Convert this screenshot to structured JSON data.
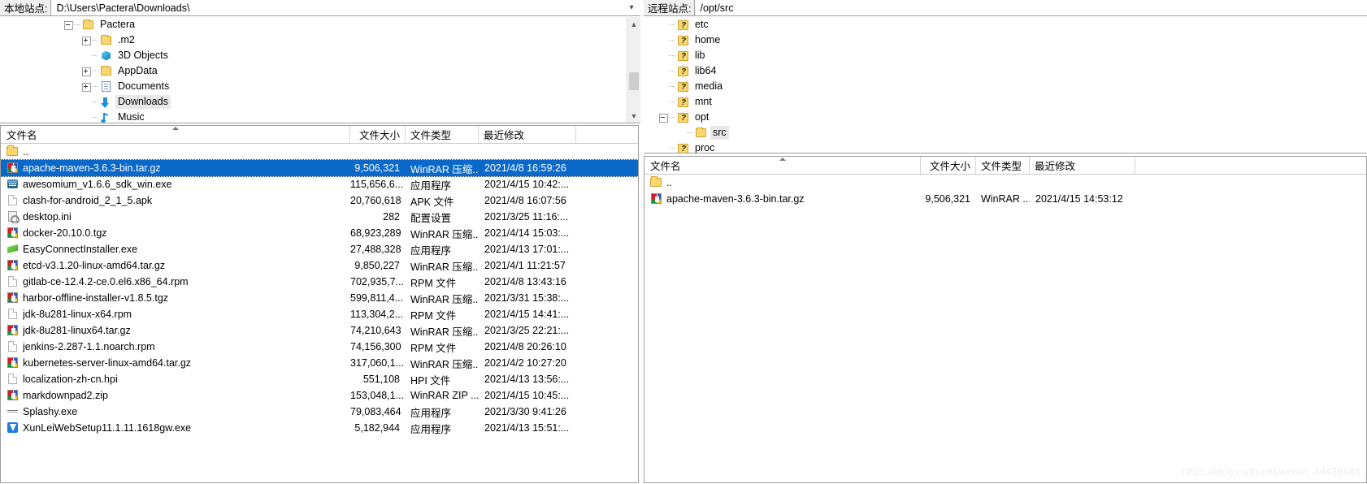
{
  "local": {
    "site_label": "本地站点:",
    "path": "D:\\Users\\Pactera\\Downloads\\",
    "dropdown_icon": "chevron-down-icon",
    "tree": [
      {
        "label": "Pactera",
        "depth": 1,
        "expander": "minus",
        "icon": "folder-icon",
        "selected": false
      },
      {
        "label": ".m2",
        "depth": 2,
        "expander": "plus",
        "icon": "folder-icon",
        "selected": false
      },
      {
        "label": "3D Objects",
        "depth": 2,
        "expander": "none",
        "icon": "3d-objects-icon",
        "selected": false
      },
      {
        "label": "AppData",
        "depth": 2,
        "expander": "plus",
        "icon": "folder-icon",
        "selected": false
      },
      {
        "label": "Documents",
        "depth": 2,
        "expander": "plus",
        "icon": "documents-icon",
        "selected": false
      },
      {
        "label": "Downloads",
        "depth": 2,
        "expander": "none",
        "icon": "downloads-icon",
        "selected": true
      },
      {
        "label": "Music",
        "depth": 2,
        "expander": "none",
        "icon": "music-icon",
        "selected": false
      }
    ],
    "columns": [
      "文件名",
      "文件大小",
      "文件类型",
      "最近修改"
    ],
    "sorted_column_index": 0,
    "files": [
      {
        "name": "..",
        "size": "",
        "type": "",
        "date": "",
        "icon": "up-folder-icon",
        "selected": false
      },
      {
        "name": "apache-maven-3.6.3-bin.tar.gz",
        "size": "9,506,321",
        "type": "WinRAR 压缩...",
        "date": "2021/4/8 16:59:26",
        "icon": "winrar-icon",
        "selected": true
      },
      {
        "name": "awesomium_v1.6.6_sdk_win.exe",
        "size": "115,656,6...",
        "type": "应用程序",
        "date": "2021/4/15 10:42:...",
        "icon": "exe-icon",
        "selected": false
      },
      {
        "name": "clash-for-android_2_1_5.apk",
        "size": "20,760,618",
        "type": "APK 文件",
        "date": "2021/4/8 16:07:56",
        "icon": "plain-file-icon",
        "selected": false
      },
      {
        "name": "desktop.ini",
        "size": "282",
        "type": "配置设置",
        "date": "2021/3/25 11:16:...",
        "icon": "ini-file-icon",
        "selected": false
      },
      {
        "name": "docker-20.10.0.tgz",
        "size": "68,923,289",
        "type": "WinRAR 压缩...",
        "date": "2021/4/14 15:03:...",
        "icon": "winrar-icon",
        "selected": false
      },
      {
        "name": "EasyConnectInstaller.exe",
        "size": "27,488,328",
        "type": "应用程序",
        "date": "2021/4/13 17:01:...",
        "icon": "green-app-icon",
        "selected": false
      },
      {
        "name": "etcd-v3.1.20-linux-amd64.tar.gz",
        "size": "9,850,227",
        "type": "WinRAR 压缩...",
        "date": "2021/4/1 11:21:57",
        "icon": "winrar-icon",
        "selected": false
      },
      {
        "name": "gitlab-ce-12.4.2-ce.0.el6.x86_64.rpm",
        "size": "702,935,7...",
        "type": "RPM 文件",
        "date": "2021/4/8 13:43:16",
        "icon": "plain-file-icon",
        "selected": false
      },
      {
        "name": "harbor-offline-installer-v1.8.5.tgz",
        "size": "599,811,4...",
        "type": "WinRAR 压缩...",
        "date": "2021/3/31 15:38:...",
        "icon": "winrar-icon",
        "selected": false
      },
      {
        "name": "jdk-8u281-linux-x64.rpm",
        "size": "113,304,2...",
        "type": "RPM 文件",
        "date": "2021/4/15 14:41:...",
        "icon": "plain-file-icon",
        "selected": false
      },
      {
        "name": "jdk-8u281-linux64.tar.gz",
        "size": "74,210,643",
        "type": "WinRAR 压缩...",
        "date": "2021/3/25 22:21:...",
        "icon": "winrar-icon",
        "selected": false
      },
      {
        "name": "jenkins-2.287-1.1.noarch.rpm",
        "size": "74,156,300",
        "type": "RPM 文件",
        "date": "2021/4/8 20:26:10",
        "icon": "plain-file-icon",
        "selected": false
      },
      {
        "name": "kubernetes-server-linux-amd64.tar.gz",
        "size": "317,060,1...",
        "type": "WinRAR 压缩...",
        "date": "2021/4/2 10:27:20",
        "icon": "winrar-icon",
        "selected": false
      },
      {
        "name": "localization-zh-cn.hpi",
        "size": "551,108",
        "type": "HPI 文件",
        "date": "2021/4/13 13:56:...",
        "icon": "plain-file-icon",
        "selected": false
      },
      {
        "name": "markdownpad2.zip",
        "size": "153,048,1...",
        "type": "WinRAR ZIP ...",
        "date": "2021/4/15 10:45:...",
        "icon": "winrar-icon",
        "selected": false
      },
      {
        "name": "Splashy.exe",
        "size": "79,083,464",
        "type": "应用程序",
        "date": "2021/3/30 9:41:26",
        "icon": "splashy-icon",
        "selected": false
      },
      {
        "name": "XunLeiWebSetup11.1.11.1618gw.exe",
        "size": "5,182,944",
        "type": "应用程序",
        "date": "2021/4/13 15:51:...",
        "icon": "xunlei-icon",
        "selected": false
      }
    ]
  },
  "remote": {
    "site_label": "远程站点:",
    "path": "/opt/src",
    "tree": [
      {
        "label": "etc",
        "depth": 1,
        "expander": "none",
        "icon": "unknown-folder-icon",
        "selected": false
      },
      {
        "label": "home",
        "depth": 1,
        "expander": "none",
        "icon": "unknown-folder-icon",
        "selected": false
      },
      {
        "label": "lib",
        "depth": 1,
        "expander": "none",
        "icon": "unknown-folder-icon",
        "selected": false
      },
      {
        "label": "lib64",
        "depth": 1,
        "expander": "none",
        "icon": "unknown-folder-icon",
        "selected": false
      },
      {
        "label": "media",
        "depth": 1,
        "expander": "none",
        "icon": "unknown-folder-icon",
        "selected": false
      },
      {
        "label": "mnt",
        "depth": 1,
        "expander": "none",
        "icon": "unknown-folder-icon",
        "selected": false
      },
      {
        "label": "opt",
        "depth": 1,
        "expander": "minus",
        "icon": "unknown-folder-icon",
        "selected": false
      },
      {
        "label": "src",
        "depth": 2,
        "expander": "none",
        "icon": "folder-icon",
        "selected": true
      },
      {
        "label": "proc",
        "depth": 1,
        "expander": "none",
        "icon": "unknown-folder-icon",
        "selected": false
      }
    ],
    "columns": [
      "文件名",
      "文件大小",
      "文件类型",
      "最近修改"
    ],
    "sorted_column_index": 0,
    "files": [
      {
        "name": "..",
        "size": "",
        "type": "",
        "date": "",
        "icon": "up-folder-icon",
        "selected": false
      },
      {
        "name": "apache-maven-3.6.3-bin.tar.gz",
        "size": "9,506,321",
        "type": "WinRAR ...",
        "date": "2021/4/15 14:53:12",
        "icon": "winrar-icon",
        "selected": false
      }
    ]
  },
  "watermark": "https://blog.csdn.net/weixin_44439488",
  "colors": {
    "selection_blue": "#0a68c8",
    "folder_yellow": "#fcd770",
    "panel_border": "#9e9e9e"
  }
}
